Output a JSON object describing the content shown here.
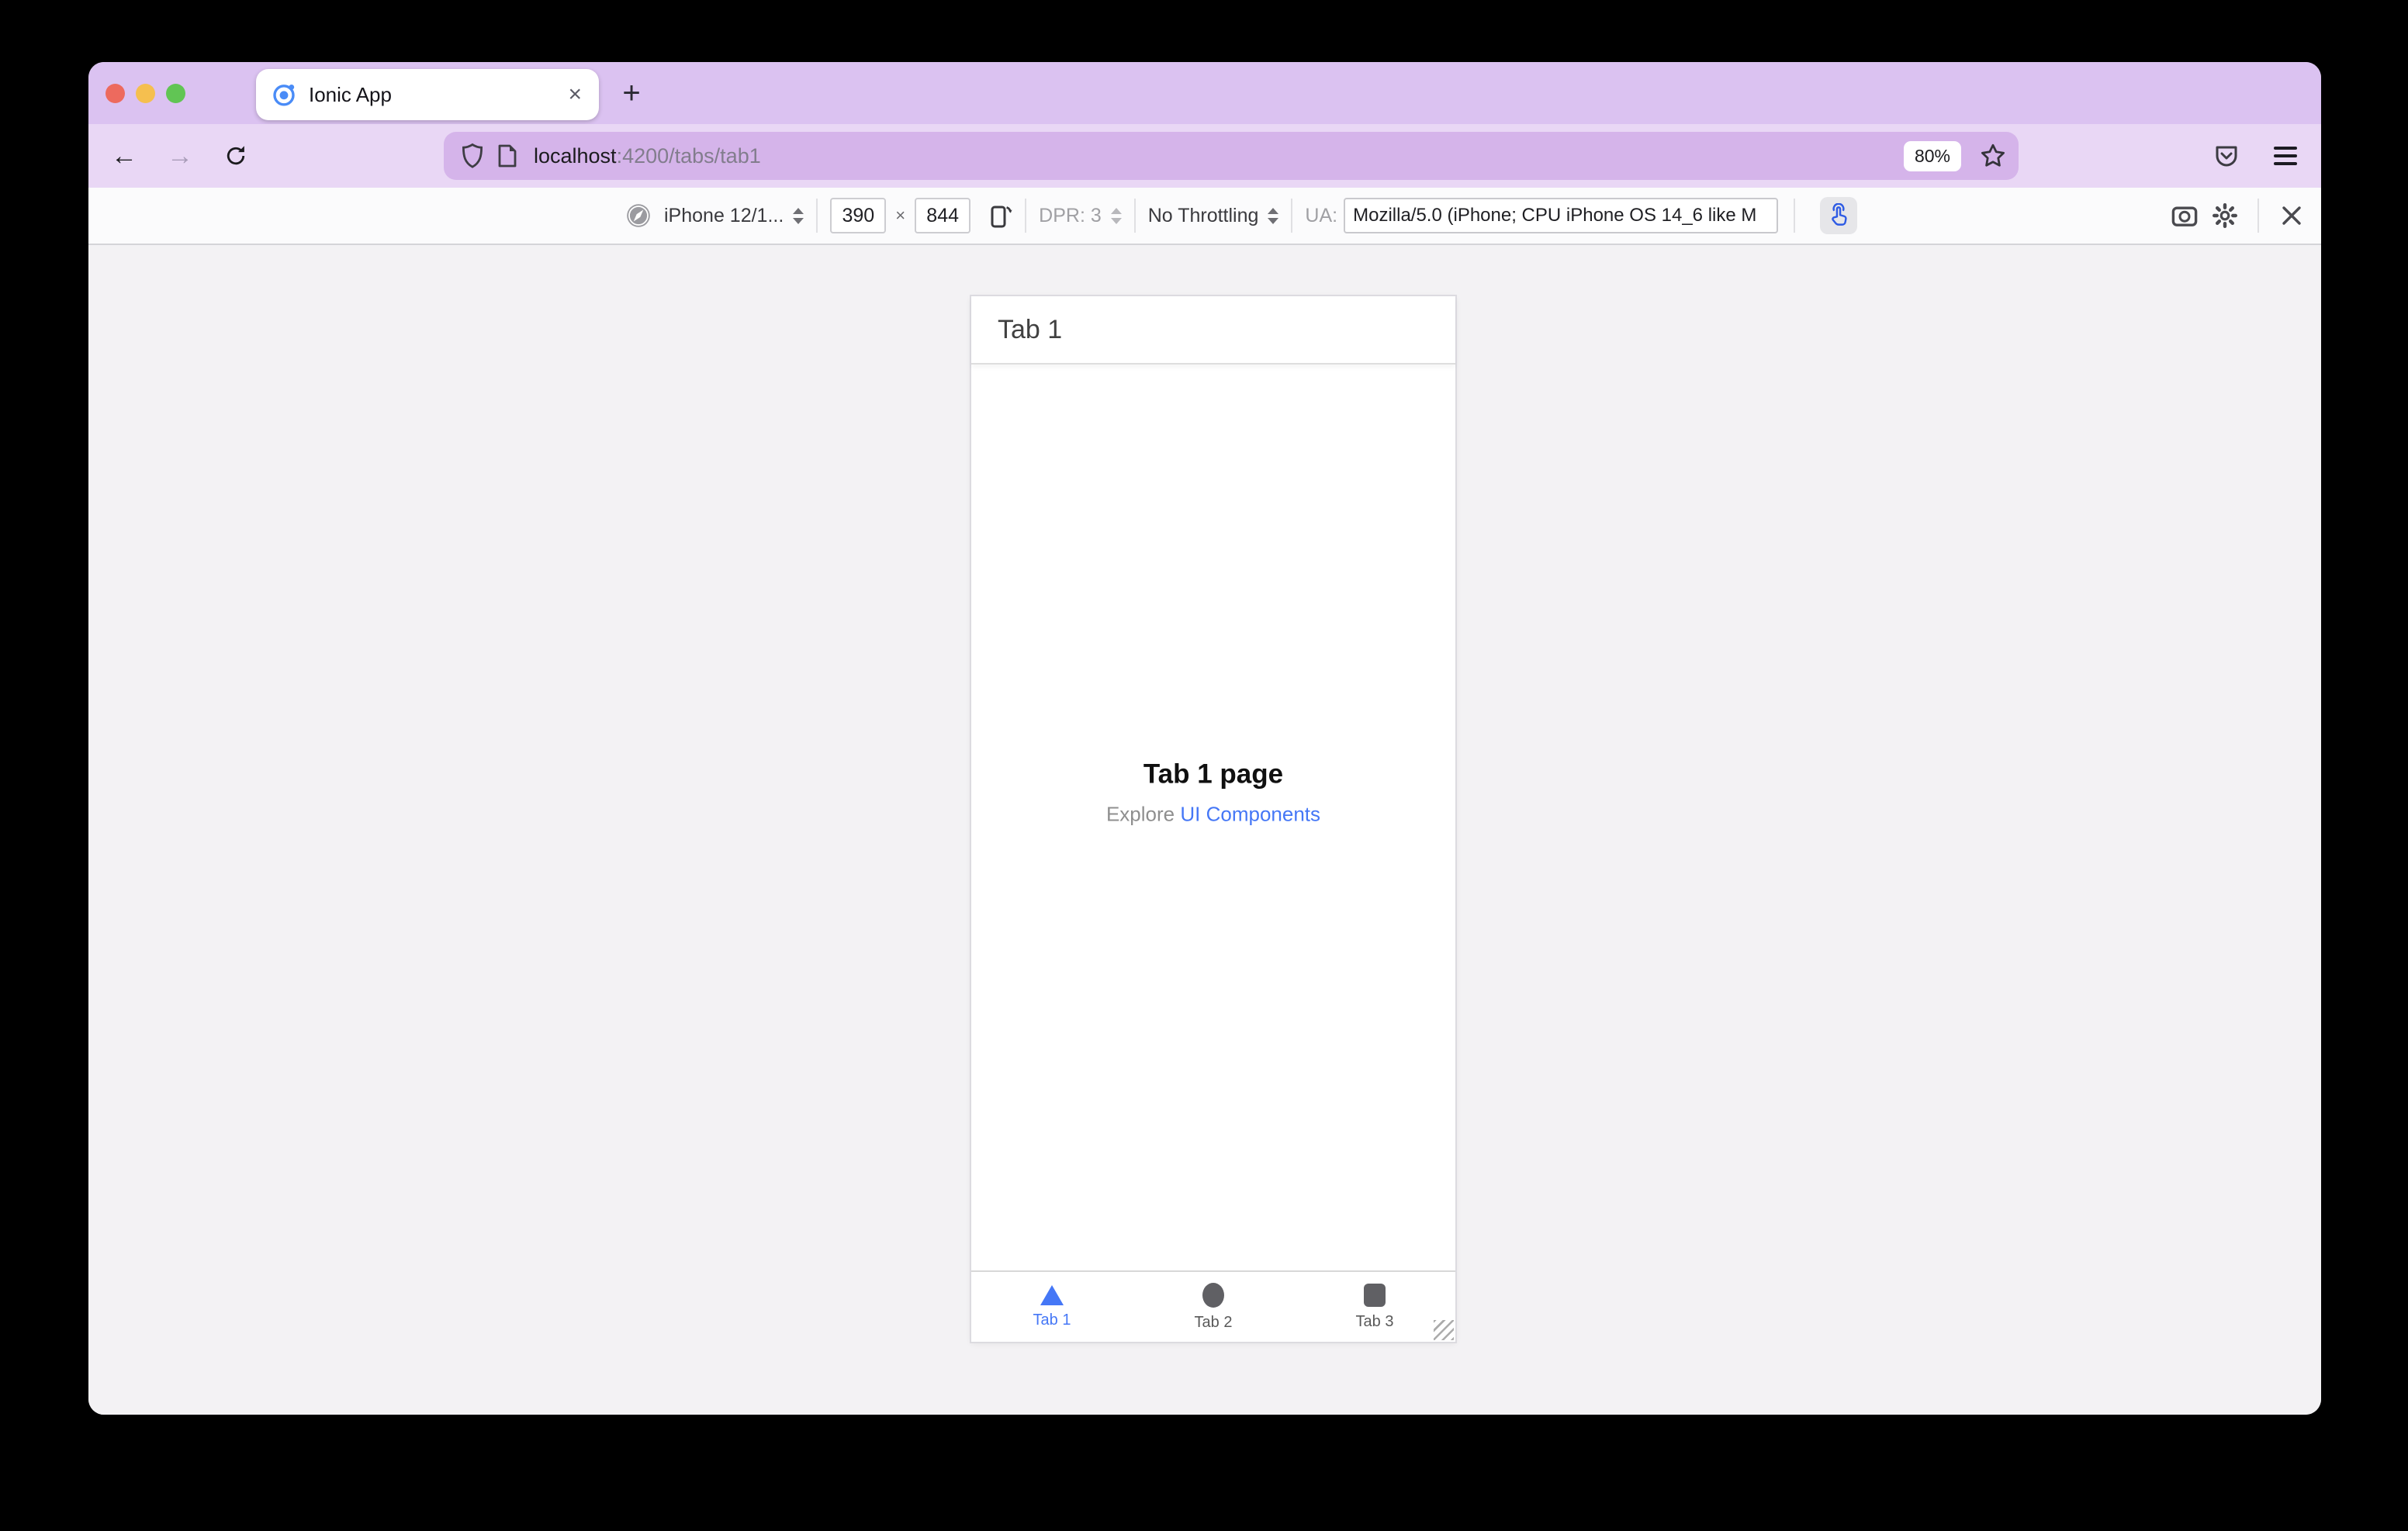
{
  "browser": {
    "tab_title": "Ionic App",
    "close_glyph": "×",
    "new_tab_glyph": "+",
    "back_glyph": "←",
    "forward_glyph": "→",
    "url_host": "localhost",
    "url_rest": ":4200/tabs/tab1",
    "zoom_badge": "80%"
  },
  "rdm": {
    "device": "iPhone 12/1...",
    "width": "390",
    "times": "×",
    "height": "844",
    "dpr": "DPR: 3",
    "throttling": "No Throttling",
    "ua_label": "UA:",
    "ua_value": "Mozilla/5.0 (iPhone; CPU iPhone OS 14_6 like M"
  },
  "app": {
    "header_title": "Tab 1",
    "page_title": "Tab 1 page",
    "explore_prefix": "Explore ",
    "explore_link": "UI Components",
    "tabs": [
      {
        "label": "Tab 1"
      },
      {
        "label": "Tab 2"
      },
      {
        "label": "Tab 3"
      }
    ]
  },
  "colors": {
    "frame_purple": "#dbc2f1",
    "toolbar_purple": "#e9d7f5",
    "urlbar_purple": "#d5b4ea",
    "accent_blue": "#4577f6",
    "touch_blue": "#2e5be4"
  }
}
